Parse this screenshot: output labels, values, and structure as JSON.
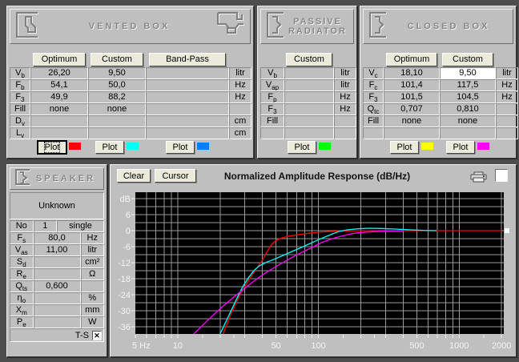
{
  "vented": {
    "title": "VENTED BOX",
    "columns": [
      "Optimum",
      "Custom",
      "Band-Pass"
    ],
    "rows": [
      {
        "l": "V",
        "s": "b",
        "v": [
          "26,20",
          "9,50",
          ""
        ],
        "u": "litr"
      },
      {
        "l": "F",
        "s": "b",
        "v": [
          "54,1",
          "50,0",
          ""
        ],
        "u": "Hz"
      },
      {
        "l": "F",
        "s": "3",
        "v": [
          "49,9",
          "88,2",
          ""
        ],
        "u": "Hz"
      },
      {
        "l": "Fill",
        "s": "",
        "v": [
          "none",
          "none",
          ""
        ],
        "u": ""
      },
      {
        "l": "D",
        "s": "v",
        "v": [
          "",
          "",
          ""
        ],
        "u": "cm"
      },
      {
        "l": "L",
        "s": "v",
        "v": [
          "",
          "",
          ""
        ],
        "u": "cm"
      }
    ],
    "plots": [
      {
        "label": "Plot",
        "color": "#ff0000",
        "focused": true
      },
      {
        "label": "Plot",
        "color": "#00ffff",
        "focused": false
      },
      {
        "label": "Plot",
        "color": "#0080ff",
        "focused": false
      }
    ]
  },
  "passive": {
    "title": "PASSIVE RADIATOR",
    "title_lines": [
      "PASSIVE",
      "RADIATOR"
    ],
    "columns": [
      "Custom"
    ],
    "rows": [
      {
        "l": "V",
        "s": "b",
        "v": [
          ""
        ],
        "u": "litr"
      },
      {
        "l": "V",
        "s": "ap",
        "v": [
          ""
        ],
        "u": "litr"
      },
      {
        "l": "F",
        "s": "p",
        "v": [
          ""
        ],
        "u": "Hz"
      },
      {
        "l": "F",
        "s": "3",
        "v": [
          ""
        ],
        "u": "Hz"
      },
      {
        "l": "Fill",
        "s": "",
        "v": [
          ""
        ],
        "u": ""
      },
      {
        "l": "",
        "s": "",
        "v": [
          ""
        ],
        "u": ""
      }
    ],
    "plots": [
      {
        "label": "Plot",
        "color": "#00ff00",
        "focused": false
      }
    ]
  },
  "closed": {
    "title": "CLOSED BOX",
    "columns": [
      "Optimum",
      "Custom"
    ],
    "rows": [
      {
        "l": "V",
        "s": "c",
        "v": [
          "18,10",
          "9,50"
        ],
        "u": "litr",
        "editable_col": 1
      },
      {
        "l": "F",
        "s": "c",
        "v": [
          "101,4",
          "117,5"
        ],
        "u": "Hz"
      },
      {
        "l": "F",
        "s": "3",
        "v": [
          "101,5",
          "104,5"
        ],
        "u": "Hz"
      },
      {
        "l": "Q",
        "s": "tc",
        "v": [
          "0,707",
          "0,810"
        ],
        "u": ""
      },
      {
        "l": "Fill",
        "s": "",
        "v": [
          "none",
          "none"
        ],
        "u": ""
      },
      {
        "l": "",
        "s": "",
        "v": [
          "",
          ""
        ],
        "u": ""
      }
    ],
    "plots": [
      {
        "label": "Plot",
        "color": "#ffff00",
        "focused": false
      },
      {
        "label": "Plot",
        "color": "#ff00ff",
        "focused": false
      }
    ]
  },
  "speaker": {
    "title": "SPEAKER",
    "name": "Unknown",
    "no_row": {
      "l": "No",
      "v": "1",
      "mode": "single"
    },
    "rows": [
      {
        "l": "F",
        "s": "s",
        "v": "80,0",
        "u": "Hz"
      },
      {
        "l": "V",
        "s": "as",
        "v": "11,00",
        "u": "litr"
      },
      {
        "l": "S",
        "s": "d",
        "v": "",
        "u": "cm²"
      },
      {
        "l": "R",
        "s": "e",
        "v": "",
        "u": "Ω"
      },
      {
        "l": "Q",
        "s": "ts",
        "v": "0,600",
        "u": ""
      },
      {
        "l": "η",
        "s": "o",
        "v": "",
        "u": "%"
      },
      {
        "l": "X",
        "s": "m",
        "v": "",
        "u": "mm"
      },
      {
        "l": "P",
        "s": "e",
        "v": "",
        "u": "W"
      }
    ],
    "footer": {
      "label": "T-S",
      "checked": true
    }
  },
  "chart": {
    "clear_label": "Clear",
    "cursor_label": "Cursor",
    "title": "Normalized Amplitude Response (dB/Hz)",
    "chart_data": {
      "type": "line",
      "title": "Normalized Amplitude Response (dB/Hz)",
      "x_scale": "log",
      "x_unit": "Hz",
      "y_unit": "dB",
      "x_range": [
        5,
        2000
      ],
      "y_range": [
        -38.7,
        14.4
      ],
      "grid": true,
      "plot_bg": "#000000",
      "grid_color": "#9c9c9c",
      "grid_db_step": 3,
      "grid_freqs": [
        6,
        7,
        8,
        9,
        10,
        20,
        30,
        40,
        50,
        60,
        70,
        80,
        90,
        100,
        200,
        300,
        400,
        500,
        600,
        700,
        800,
        900,
        1000,
        2000
      ],
      "tick_freqs": [
        5,
        6,
        7,
        8,
        9,
        10,
        15,
        20,
        25,
        30,
        40,
        50,
        60,
        70,
        80,
        90,
        100,
        150,
        200,
        250,
        300,
        400,
        500,
        600,
        700,
        800,
        900,
        1000,
        1500,
        2000
      ],
      "x_tick_labels": [
        {
          "label": "5 Hz",
          "f": 5
        },
        {
          "label": "10",
          "f": 10
        },
        {
          "label": "50",
          "f": 50
        },
        {
          "label": "100",
          "f": 100
        },
        {
          "label": "500",
          "f": 500
        },
        {
          "label": "1000",
          "f": 1000
        },
        {
          "label": "2000",
          "f": 2000
        }
      ],
      "y_tick_labels": [
        {
          "label": "dB",
          "v": 12
        },
        {
          "label": "6",
          "v": 6
        },
        {
          "label": "0",
          "v": 0
        },
        {
          "label": "-6",
          "v": -6
        },
        {
          "label": "-12",
          "v": -12
        },
        {
          "label": "-18",
          "v": -18
        },
        {
          "label": "-24",
          "v": -24
        },
        {
          "label": "-30",
          "v": -30
        },
        {
          "label": "-36",
          "v": -36
        }
      ],
      "series": [
        {
          "name": "vented-box-optimum",
          "color": "#ff0000",
          "points": [
            [
              21,
              -39
            ],
            [
              24,
              -31
            ],
            [
              28,
              -23.5
            ],
            [
              32,
              -18.5
            ],
            [
              36,
              -14.5
            ],
            [
              40,
              -11
            ],
            [
              43,
              -8
            ],
            [
              46,
              -5.5
            ],
            [
              49,
              -4
            ],
            [
              53,
              -3
            ],
            [
              60,
              -2.2
            ],
            [
              70,
              -1.6
            ],
            [
              85,
              -1.0
            ],
            [
              100,
              -0.6
            ],
            [
              120,
              -0.3
            ],
            [
              150,
              -0.1
            ],
            [
              200,
              0
            ],
            [
              2000,
              0
            ]
          ]
        },
        {
          "name": "vented-box-custom",
          "color": "#00ffff",
          "points": [
            [
              20,
              -39
            ],
            [
              23,
              -32
            ],
            [
              26,
              -26
            ],
            [
              29,
              -21
            ],
            [
              32,
              -17.5
            ],
            [
              35,
              -14.8
            ],
            [
              38,
              -13.2
            ],
            [
              42,
              -12
            ],
            [
              46,
              -11.2
            ],
            [
              50,
              -10.4
            ],
            [
              56,
              -9.3
            ],
            [
              63,
              -8.1
            ],
            [
              71,
              -6.9
            ],
            [
              80,
              -5.7
            ],
            [
              90,
              -4.5
            ],
            [
              100,
              -3.4
            ],
            [
              112,
              -2.3
            ],
            [
              126,
              -1.2
            ],
            [
              140,
              -0.3
            ],
            [
              160,
              0.3
            ],
            [
              190,
              0.7
            ],
            [
              230,
              0.9
            ],
            [
              280,
              0.8
            ],
            [
              350,
              0.6
            ],
            [
              450,
              0.3
            ],
            [
              560,
              0.1
            ],
            [
              690,
              0
            ]
          ]
        },
        {
          "name": "closed-box-custom",
          "color": "#ff00ff",
          "points": [
            [
              13,
              -39
            ],
            [
              15,
              -35.5
            ],
            [
              18,
              -31.5
            ],
            [
              21,
              -28.3
            ],
            [
              25,
              -24.9
            ],
            [
              30,
              -21.5
            ],
            [
              36,
              -18.3
            ],
            [
              43,
              -15.5
            ],
            [
              52,
              -12.9
            ],
            [
              62,
              -10.6
            ],
            [
              75,
              -8.3
            ],
            [
              90,
              -6.3
            ],
            [
              105,
              -4.5
            ],
            [
              125,
              -3.0
            ],
            [
              150,
              -1.9
            ],
            [
              180,
              -1.0
            ],
            [
              220,
              -0.5
            ],
            [
              280,
              -0.25
            ],
            [
              400,
              -0.15
            ]
          ]
        }
      ],
      "cursor_marker": {
        "f": 2000,
        "v": 0,
        "color": "#ffffff"
      }
    }
  }
}
